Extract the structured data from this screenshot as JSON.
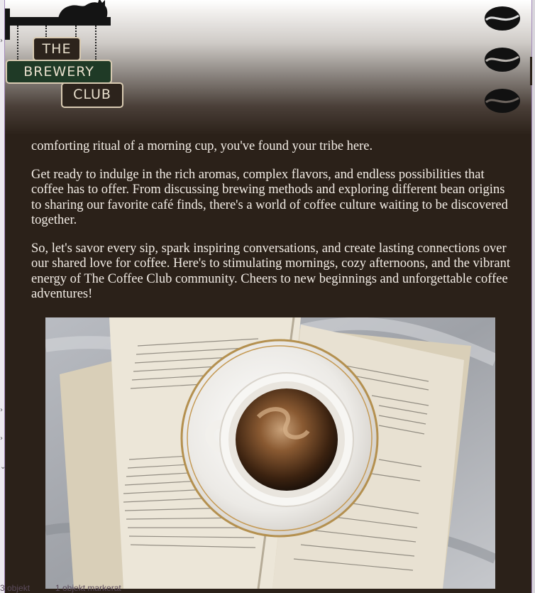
{
  "logo": {
    "line1": "THE",
    "line2": "BREWERY",
    "line3": "CLUB"
  },
  "nav": {
    "icons": [
      "coffee-bean-icon",
      "coffee-bean-icon",
      "coffee-bean-icon"
    ]
  },
  "article": {
    "paragraphs": [
      "comforting ritual of a morning cup, you've found your tribe here.",
      "Get ready to indulge in the rich aromas, complex flavors, and endless possibilities that coffee has to offer. From discussing brewing methods and exploring different bean origins to sharing our favorite café finds, there's a world of coffee culture waiting to be discovered together.",
      "So, let's savor every sip, spark inspiring conversations, and create lasting connections over our shared love for coffee. Here's to stimulating mornings, cozy afternoons, and the vibrant energy of The Coffee Club community. Cheers to new beginnings and unforgettable coffee adventures!"
    ]
  },
  "colors": {
    "page_background": "#2b2119",
    "text": "#f3ede6",
    "logo_sign": "#2c231c",
    "logo_sign_accent": "#1f3a26"
  },
  "bottom_bar": {
    "label1": "3 objekt",
    "label2": "1 objekt markerat"
  }
}
